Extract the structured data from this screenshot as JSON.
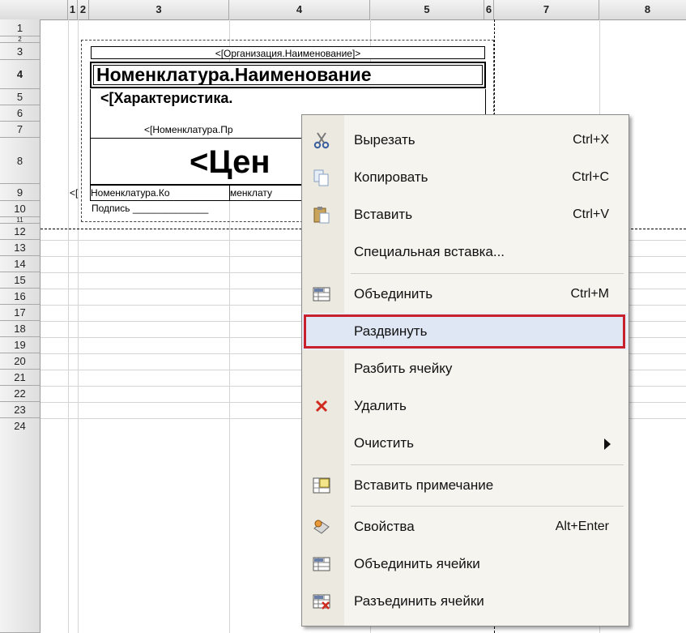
{
  "columns": [
    "1",
    "2",
    "3",
    "4",
    "5",
    "6",
    "7",
    "8"
  ],
  "rows": [
    "1",
    "2",
    "3",
    "4",
    "5",
    "6",
    "7",
    "8",
    "9",
    "10",
    "11",
    "12",
    "13",
    "14",
    "15",
    "16",
    "17",
    "18",
    "19",
    "20",
    "21",
    "22",
    "23",
    "24"
  ],
  "cells": {
    "org": "<[Организация.Наименование]>",
    "nom": "Номенклатура.Наименование",
    "char": "<[Характеристика.",
    "nom_pr": "<[Номенклатура.Пр",
    "price": "<Цен",
    "r9a": "<[",
    "r9b": "Номенклатура.Ко",
    "r9c": "менклату",
    "sign": "Подпись ______________"
  },
  "menu": {
    "items": [
      {
        "label": "Вырезать",
        "shortcut": "Ctrl+X",
        "icon": "scissors-icon"
      },
      {
        "label": "Копировать",
        "shortcut": "Ctrl+C",
        "icon": "copy-icon"
      },
      {
        "label": "Вставить",
        "shortcut": "Ctrl+V",
        "icon": "paste-icon"
      },
      {
        "label": "Специальная вставка...",
        "shortcut": "",
        "icon": ""
      },
      {
        "label": "Объединить",
        "shortcut": "Ctrl+M",
        "icon": "merge-icon"
      },
      {
        "label": "Раздвинуть",
        "shortcut": "",
        "icon": ""
      },
      {
        "label": "Разбить ячейку",
        "shortcut": "",
        "icon": ""
      },
      {
        "label": "Удалить",
        "shortcut": "",
        "icon": "delete-icon"
      },
      {
        "label": "Очистить",
        "shortcut": "",
        "icon": ""
      },
      {
        "label": "Вставить примечание",
        "shortcut": "",
        "icon": "note-icon"
      },
      {
        "label": "Свойства",
        "shortcut": "Alt+Enter",
        "icon": "properties-icon"
      },
      {
        "label": "Объединить ячейки",
        "shortcut": "",
        "icon": "merge-cells-icon"
      },
      {
        "label": "Разъединить ячейки",
        "shortcut": "",
        "icon": "unmerge-cells-icon"
      }
    ],
    "highlighted": "Раздвинуть"
  }
}
